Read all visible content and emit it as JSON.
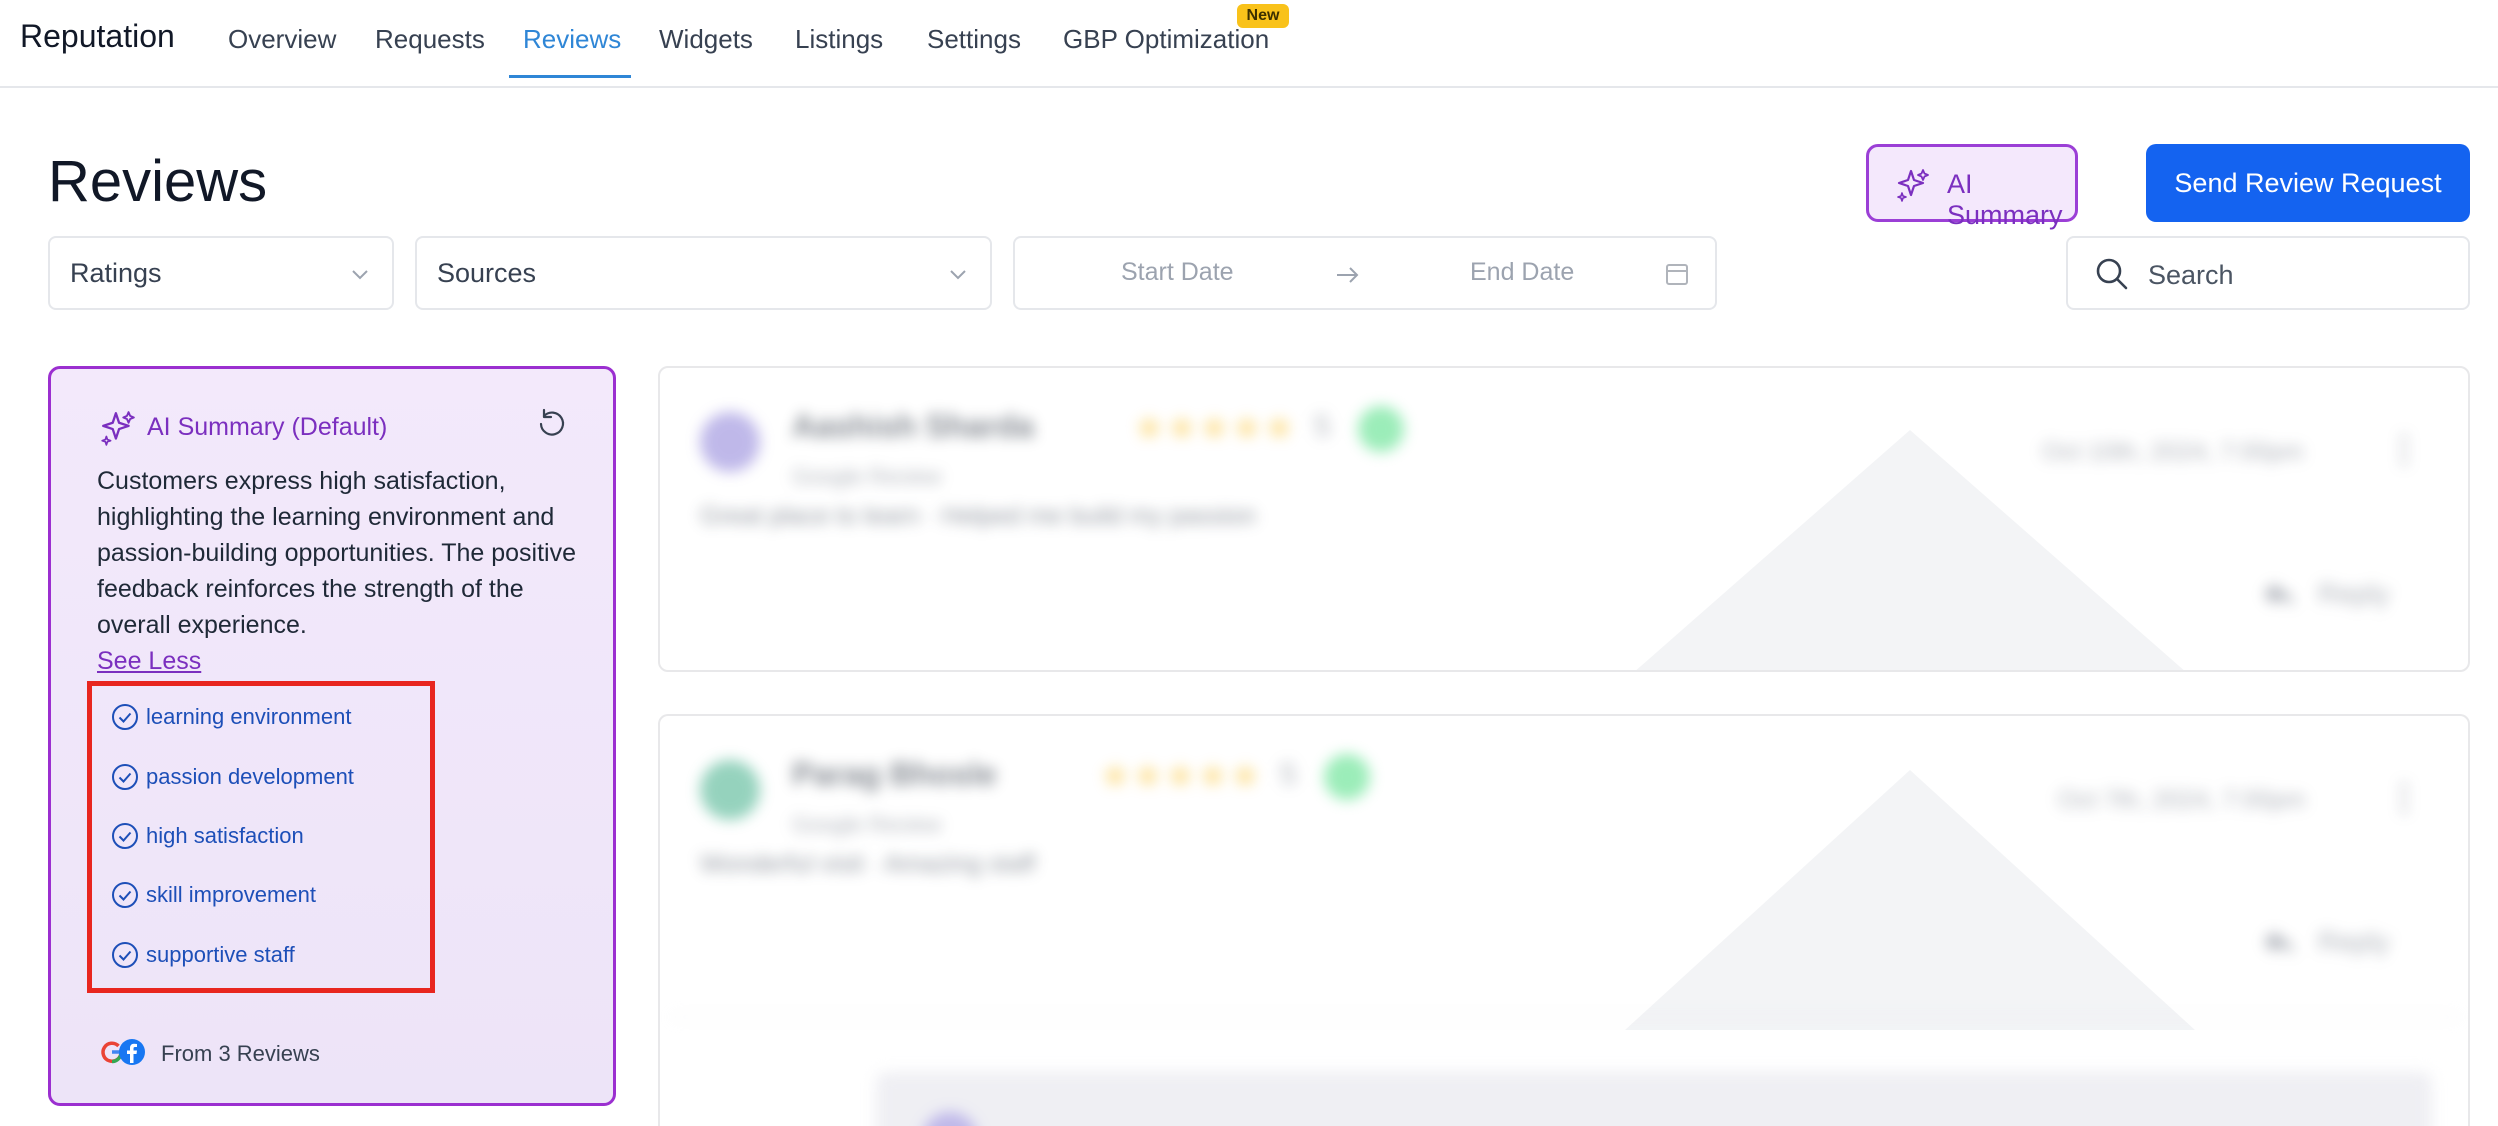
{
  "app": {
    "brand": "Reputation",
    "tabs": [
      "Overview",
      "Requests",
      "Reviews",
      "Widgets",
      "Listings",
      "Settings",
      "GBP Optimization"
    ],
    "active_tab": "Reviews",
    "new_badge": "New"
  },
  "page": {
    "title": "Reviews",
    "ai_summary_button": "AI Summary",
    "send_request_button": "Send Review Request"
  },
  "filters": {
    "ratings": "Ratings",
    "sources": "Sources",
    "start_date": "Start Date",
    "end_date": "End Date",
    "search_placeholder": "Search"
  },
  "summary": {
    "title": "AI Summary (Default)",
    "text": "Customers express high satisfaction, highlighting the learning environment and passion-building opportunities. The positive feedback reinforces the strength of the overall experience.",
    "see_less": "See Less",
    "tags": [
      "learning environment",
      "passion development",
      "high satisfaction",
      "skill improvement",
      "supportive staff"
    ],
    "footer": "From 3 Reviews",
    "accent_color": "#9b2fd0",
    "highlight_color": "#e8261f"
  },
  "reviews": [
    {
      "name": "Aashish Sharda",
      "sub": "Google Review",
      "stars": "★★★★★",
      "rating": "5",
      "text": "Great place to learn · Helped me build my passion",
      "date": "Oct 10th, 2024, 7:00pm",
      "reply": "Reply"
    },
    {
      "name": "Parag Bhosle",
      "sub": "Google Review",
      "stars": "★★★★★",
      "rating": "5",
      "text": "Wonderful visit · Amazing staff",
      "date": "Oct 7th, 2024, 7:00pm",
      "reply": "Reply"
    }
  ],
  "colors": {
    "brand_blue": "#1463f0",
    "active_tab": "#2f86d6",
    "ai_purple": "#7b2fbf"
  }
}
